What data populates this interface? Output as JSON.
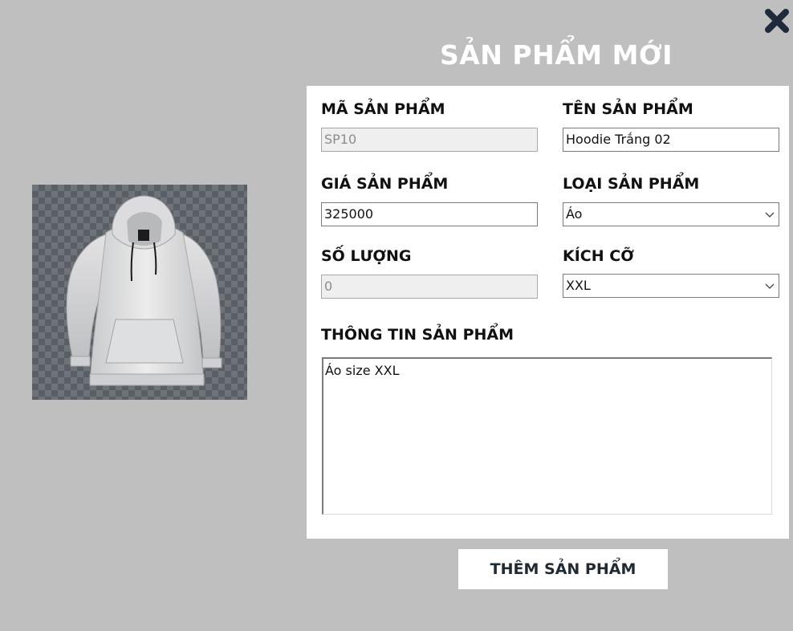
{
  "header": {
    "title": "SẢN PHẨM MỚI",
    "close_icon": "close-x-icon"
  },
  "image": {
    "icon": "hoodie-product-image",
    "background": "transparency-checkerboard"
  },
  "form": {
    "product_code": {
      "label": "MÃ SẢN PHẨM",
      "value": "SP10",
      "disabled": true
    },
    "product_name": {
      "label": "TÊN SẢN PHẨM",
      "value": "Hoodie Trắng 02"
    },
    "product_price": {
      "label": "GIÁ SẢN PHẨM",
      "value": "325000"
    },
    "product_category": {
      "label": "LOẠI SẢN PHẨM",
      "selected": "Áo"
    },
    "quantity": {
      "label": "SỐ LƯỢNG",
      "value": "0",
      "disabled": true
    },
    "size": {
      "label": "KÍCH CỠ",
      "selected": "XXL"
    },
    "description": {
      "label": "THÔNG TIN SẢN PHẨM",
      "value": "Áo size XXL"
    }
  },
  "actions": {
    "submit_label": "THÊM SẢN PHẨM"
  },
  "colors": {
    "background": "#bfbfbf",
    "card": "#ffffff",
    "close_icon": "#1f2a3a",
    "button_text": "#1f2a33"
  }
}
